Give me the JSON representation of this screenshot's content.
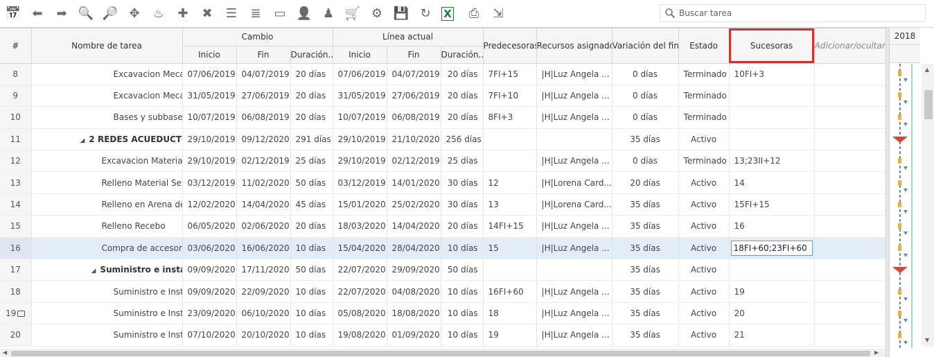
{
  "toolbar": {
    "icons": [
      "calendar-icon",
      "arrow-left-icon",
      "arrow-right-icon",
      "zoom-out-icon",
      "zoom-in-icon",
      "move-icon",
      "fire-icon",
      "add-icon",
      "delete-icon",
      "indent-icon",
      "outdent-icon",
      "link-icon",
      "resource-icon",
      "dependency-icon",
      "cart-icon",
      "gear-icon",
      "save-icon",
      "refresh-icon",
      "excel-icon",
      "print-icon",
      "export-icon"
    ]
  },
  "search": {
    "placeholder": "Buscar tarea"
  },
  "columns": {
    "num": "#",
    "name": "Nombre de tarea",
    "cambio": "Cambio",
    "linea": "Línea actual",
    "inicio": "Inicio",
    "fin": "Fin",
    "duracion": "Duración..",
    "predecesoras": "Predecesoras",
    "recursos": "Recursos asignados",
    "variacion": "Variación del fin",
    "estado": "Estado",
    "sucesoras": "Sucesoras",
    "adicionar": "Adicionar/ocultar"
  },
  "gantt": {
    "year": "2018"
  },
  "rows": [
    {
      "num": "8",
      "name": "Excavacion Mecanica con",
      "indent": 2,
      "c_ini": "07/06/2019",
      "c_fin": "04/07/2019",
      "c_dur": "20 días",
      "l_ini": "07/06/2019",
      "l_fin": "04/07/2019",
      "l_dur": "20 días",
      "pred": "7FI+15",
      "rec": "|H|Luz Angela ...",
      "var": "0 días",
      "estado": "Terminado",
      "suc": "10FI+3"
    },
    {
      "num": "9",
      "name": "Excavacion Mecanica con",
      "indent": 2,
      "c_ini": "31/05/2019",
      "c_fin": "27/06/2019",
      "c_dur": "20 días",
      "l_ini": "31/05/2019",
      "l_fin": "27/06/2019",
      "l_dur": "20 días",
      "pred": "7FI+10",
      "rec": "|H|Luz Angela ...",
      "var": "0 días",
      "estado": "Terminado",
      "suc": ""
    },
    {
      "num": "10",
      "name": "Bases y subbases Casas,",
      "indent": 2,
      "c_ini": "10/07/2019",
      "c_fin": "06/08/2019",
      "c_dur": "20 días",
      "l_ini": "10/07/2019",
      "l_fin": "06/08/2019",
      "l_dur": "20 días",
      "pred": "8FI+3",
      "rec": "|H|Luz Angela ...",
      "var": "0 días",
      "estado": "Terminado",
      "suc": ""
    },
    {
      "num": "11",
      "name": "2 REDES ACUEDUCTO U.I.",
      "indent": 0,
      "group": true,
      "c_ini": "29/10/2019",
      "c_fin": "09/12/2020",
      "c_dur": "291 días",
      "l_ini": "29/10/2019",
      "l_fin": "21/10/2020",
      "l_dur": "256 días",
      "pred": "",
      "rec": "",
      "var": "35 días",
      "estado": "Activo",
      "suc": ""
    },
    {
      "num": "12",
      "name": "Excavacion Material Comun",
      "indent": 1,
      "c_ini": "29/10/2019",
      "c_fin": "02/12/2019",
      "c_dur": "25 días",
      "l_ini": "29/10/2019",
      "l_fin": "02/12/2019",
      "l_dur": "25 días",
      "pred": "",
      "rec": "|H|Luz Angela ...",
      "var": "0 días",
      "estado": "Terminado",
      "suc": "13;23II+12"
    },
    {
      "num": "13",
      "name": "Relleno Material Seleccionad",
      "indent": 1,
      "c_ini": "03/12/2019",
      "c_fin": "11/02/2020",
      "c_dur": "50 días",
      "l_ini": "03/12/2019",
      "l_fin": "14/01/2020",
      "l_dur": "30 días",
      "pred": "12",
      "rec": "|H|Lorena Card...",
      "var": "20 días",
      "estado": "Activo",
      "suc": "14"
    },
    {
      "num": "14",
      "name": "Relleno en Arena de Peña",
      "indent": 1,
      "c_ini": "12/02/2020",
      "c_fin": "14/04/2020",
      "c_dur": "45 días",
      "l_ini": "15/01/2020",
      "l_fin": "25/02/2020",
      "l_dur": "30 días",
      "pred": "13",
      "rec": "|H|Lorena Card...",
      "var": "35 días",
      "estado": "Activo",
      "suc": "15FI+15"
    },
    {
      "num": "15",
      "name": "Relleno Recebo",
      "indent": 1,
      "c_ini": "06/05/2020",
      "c_fin": "02/06/2020",
      "c_dur": "20 días",
      "l_ini": "18/03/2020",
      "l_fin": "14/04/2020",
      "l_dur": "20 días",
      "pred": "14FI+15",
      "rec": "|H|Luz Angela ...",
      "var": "35 días",
      "estado": "Activo",
      "suc": "16"
    },
    {
      "num": "16",
      "name": "Compra de accesorios",
      "indent": 1,
      "sel": true,
      "c_ini": "03/06/2020",
      "c_fin": "16/06/2020",
      "c_dur": "10 días",
      "l_ini": "15/04/2020",
      "l_fin": "28/04/2020",
      "l_dur": "10 días",
      "pred": "15",
      "rec": "|H|Luz Angela ...",
      "var": "35 días",
      "estado": "Activo",
      "suc": "18FI+60;23FI+60"
    },
    {
      "num": "17",
      "name": "Suministro e instalación",
      "indent": 1,
      "group": true,
      "c_ini": "09/09/2020",
      "c_fin": "17/11/2020",
      "c_dur": "50 días",
      "l_ini": "22/07/2020",
      "l_fin": "29/09/2020",
      "l_dur": "50 días",
      "pred": "",
      "rec": "",
      "var": "35 días",
      "estado": "Activo",
      "suc": ""
    },
    {
      "num": "18",
      "name": "Suministro e Instalacion",
      "indent": 2,
      "c_ini": "09/09/2020",
      "c_fin": "22/09/2020",
      "c_dur": "10 días",
      "l_ini": "22/07/2020",
      "l_fin": "04/08/2020",
      "l_dur": "10 días",
      "pred": "16FI+60",
      "rec": "|H|Luz Angela ...",
      "var": "35 días",
      "estado": "Activo",
      "suc": "19"
    },
    {
      "num": "19",
      "name": "Suministro e Instalacion",
      "indent": 2,
      "comment": true,
      "c_ini": "23/09/2020",
      "c_fin": "06/10/2020",
      "c_dur": "10 días",
      "l_ini": "05/08/2020",
      "l_fin": "18/08/2020",
      "l_dur": "10 días",
      "pred": "18",
      "rec": "|H|Luz Angela ...",
      "var": "35 días",
      "estado": "Activo",
      "suc": "20"
    },
    {
      "num": "20",
      "name": "Suministro e Instalacion",
      "indent": 2,
      "c_ini": "07/10/2020",
      "c_fin": "20/10/2020",
      "c_dur": "10 días",
      "l_ini": "19/08/2020",
      "l_fin": "01/09/2020",
      "l_dur": "10 días",
      "pred": "19",
      "rec": "|H|Luz Angela ...",
      "var": "35 días",
      "estado": "Activo",
      "suc": "21"
    }
  ]
}
